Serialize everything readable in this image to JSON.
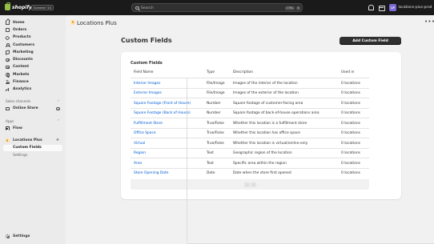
{
  "topbar": {
    "logo_text": "shopify",
    "edition_badge": "Summer '24",
    "search_placeholder": "Search",
    "shortcut_keys": [
      "CTRL",
      "K"
    ],
    "store_avatar": "LP",
    "store_name": "locations-plus-prod"
  },
  "sidebar": {
    "nav": [
      {
        "label": "Home",
        "icon": "home-icon"
      },
      {
        "label": "Orders",
        "icon": "orders-icon"
      },
      {
        "label": "Products",
        "icon": "tag-icon"
      },
      {
        "label": "Customers",
        "icon": "person-icon"
      },
      {
        "label": "Marketing",
        "icon": "megaphone-icon"
      },
      {
        "label": "Discounts",
        "icon": "discount-icon"
      },
      {
        "label": "Content",
        "icon": "content-icon"
      },
      {
        "label": "Markets",
        "icon": "globe-icon"
      },
      {
        "label": "Finance",
        "icon": "bank-icon"
      },
      {
        "label": "Analytics",
        "icon": "bar-chart-icon"
      }
    ],
    "sales_channels_heading": "Sales channels",
    "online_store": "Online Store",
    "apps_heading": "Apps",
    "flow": "Flow",
    "app_name": "Locations Plus",
    "app_subnav": [
      {
        "label": "Custom Fields",
        "active": true
      },
      {
        "label": "Settings",
        "active": false
      }
    ],
    "settings": "Settings"
  },
  "app_header": {
    "title": "Locations Plus",
    "more": "•••"
  },
  "page": {
    "title": "Custom Fields",
    "add_button": "Add Custom Field"
  },
  "card": {
    "title": "Custom Fields",
    "columns": [
      "Field Name",
      "Type",
      "Description",
      "Used in"
    ],
    "rows": [
      {
        "name": "Interior Images",
        "type": "File/Image",
        "description": "Images of the interior of the location",
        "used": "0 locations"
      },
      {
        "name": "Exterior Images",
        "type": "File/Image",
        "description": "Images of the exterior of the location",
        "used": "0 locations"
      },
      {
        "name": "Square Footage (Front of House)",
        "type": "Number",
        "description": "Square footage of customer-facing area",
        "used": "0 locations"
      },
      {
        "name": "Square Footage (Back of House)",
        "type": "Number",
        "description": "Square footage of back-of-house operations area",
        "used": "0 locations"
      },
      {
        "name": "Fulfillment Store",
        "type": "True/False",
        "description": "Whether this location is a fulfillment store",
        "used": "0 locations"
      },
      {
        "name": "Office Space",
        "type": "True/False",
        "description": "Whether this location has office space",
        "used": "0 locations"
      },
      {
        "name": "Virtual",
        "type": "True/False",
        "description": "Whether this location is virtual/online-only",
        "used": "0 locations"
      },
      {
        "name": "Region",
        "type": "Text",
        "description": "Geographic region of the location",
        "used": "0 locations"
      },
      {
        "name": "Area",
        "type": "Text",
        "description": "Specific area within the region",
        "used": "0 locations"
      },
      {
        "name": "Store Opening Date",
        "type": "Date",
        "description": "Date when the store first opened",
        "used": "0 locations"
      }
    ],
    "pagination": {
      "prev": "‹",
      "next": "›"
    }
  },
  "colors": {
    "topbar": "#1a1a1a",
    "link": "#005bd3",
    "primary_button": "#303030",
    "background": "#f1f1f1"
  }
}
